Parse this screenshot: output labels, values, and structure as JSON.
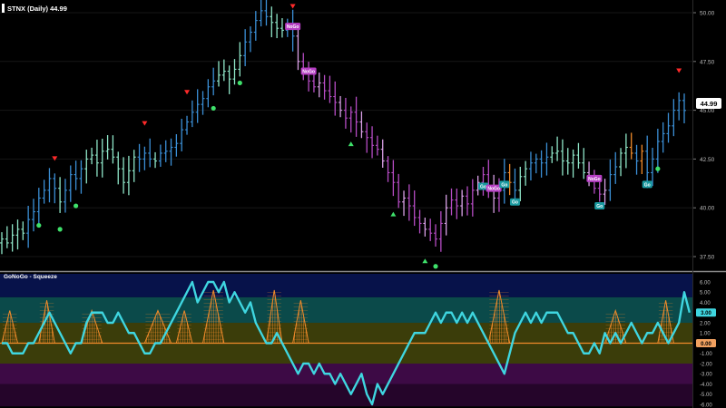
{
  "price_panel": {
    "title": "STNX (Daily) 44.99",
    "last_price_label": "44.99",
    "y_ticks": [
      "50.00",
      "47.50",
      "45.00",
      "42.50",
      "40.00",
      "37.50"
    ]
  },
  "indicator_panel": {
    "title": "GoNoGo - Squeeze",
    "y_ticks": [
      "6.00",
      "5.00",
      "4.00",
      "3.00",
      "2.00",
      "1.00",
      "0.00",
      "-1.00",
      "-2.00",
      "-3.00",
      "-4.00",
      "-5.00",
      "-6.00"
    ],
    "highlight_label": "3.00",
    "zero_label": "0.00"
  },
  "colors": {
    "go_strong": "#3b8fd6",
    "go_weak": "#8fe6c8",
    "nogo_strong": "#b64cc4",
    "nogo_weak": "#d9a0e6",
    "amber": "#f08a2a",
    "oscillator": "#3fd6e0",
    "band_top": "#07124a",
    "band_teal": "#0b4a4a",
    "band_olive": "#3b3d0a",
    "band_purple": "#3d0a45",
    "band_dark_purple": "#25052a"
  },
  "chart_data": [
    {
      "type": "ohlc",
      "title": "STNX (Daily) 44.99",
      "ylim": [
        37.0,
        50.5
      ],
      "series": [
        {
          "name": "price",
          "values": [
            38.4,
            38.2,
            38.6,
            38.9,
            38.7,
            39.4,
            39.8,
            40.5,
            40.9,
            41.5,
            41.0,
            40.3,
            40.9,
            41.7,
            41.5,
            42.0,
            42.5,
            42.7,
            42.3,
            42.9,
            43.0,
            42.6,
            42.0,
            41.3,
            41.9,
            42.6,
            42.5,
            42.8,
            42.5,
            42.4,
            42.8,
            42.9,
            43.1,
            43.3,
            44.0,
            44.4,
            44.9,
            45.3,
            45.6,
            46.2,
            46.5,
            46.8,
            47.0,
            46.6,
            47.1,
            47.8,
            48.5,
            49.0,
            49.6,
            50.1,
            49.8,
            49.5,
            49.2,
            49.1,
            49.4,
            48.8,
            47.5,
            46.9,
            46.5,
            46.2,
            46.4,
            46.0,
            45.7,
            45.4,
            45.0,
            44.6,
            44.9,
            44.4,
            43.9,
            43.6,
            43.2,
            43.0,
            42.4,
            41.8,
            41.3,
            40.3,
            40.5,
            40.1,
            39.5,
            39.2,
            38.9,
            38.7,
            38.4,
            39.2,
            40.0,
            40.4,
            40.1,
            40.6,
            40.2,
            40.9,
            41.3,
            41.7,
            41.1,
            40.5,
            40.9,
            41.8,
            41.3,
            40.9,
            41.6,
            42.0,
            42.3,
            42.5,
            42.3,
            42.6,
            42.8,
            42.9,
            42.4,
            42.3,
            42.7,
            42.3,
            41.8,
            41.4,
            41.0,
            40.7,
            40.9,
            41.7,
            42.1,
            42.8,
            43.1,
            42.8,
            42.4,
            42.9,
            41.8,
            42.5,
            43.4,
            43.8,
            44.2,
            45.0,
            45.5,
            44.99
          ]
        }
      ],
      "markers": [
        {
          "bar": 7,
          "kind": "go_dot"
        },
        {
          "bar": 11,
          "kind": "go_dot"
        },
        {
          "bar": 14,
          "kind": "go_dot"
        },
        {
          "bar": 40,
          "kind": "go_dot"
        },
        {
          "bar": 45,
          "kind": "go_dot"
        },
        {
          "bar": 82,
          "kind": "go_dot"
        },
        {
          "bar": 124,
          "kind": "go_dot"
        },
        {
          "bar": 10,
          "kind": "nogo_triangle"
        },
        {
          "bar": 27,
          "kind": "nogo_triangle"
        },
        {
          "bar": 35,
          "kind": "nogo_triangle"
        },
        {
          "bar": 48,
          "kind": "nogo_triangle"
        },
        {
          "bar": 55,
          "kind": "nogo_triangle"
        },
        {
          "bar": 128,
          "kind": "nogo_triangle"
        },
        {
          "bar": 66,
          "kind": "go_triangle_up"
        },
        {
          "bar": 74,
          "kind": "go_triangle_up"
        },
        {
          "bar": 80,
          "kind": "go_triangle_up"
        }
      ],
      "badges": [
        {
          "bar": 55,
          "text": "NoGo",
          "kind": "nogo"
        },
        {
          "bar": 58,
          "text": "NoGo",
          "kind": "nogo"
        },
        {
          "bar": 91,
          "text": "Go",
          "kind": "go"
        },
        {
          "bar": 93,
          "text": "NoGo",
          "kind": "nogo"
        },
        {
          "bar": 95,
          "text": "Go",
          "kind": "go"
        },
        {
          "bar": 97,
          "text": "Go",
          "kind": "go"
        },
        {
          "bar": 112,
          "text": "NoGo",
          "kind": "nogo"
        },
        {
          "bar": 113,
          "text": "Go",
          "kind": "go"
        },
        {
          "bar": 122,
          "text": "Go",
          "kind": "go"
        }
      ]
    },
    {
      "type": "line",
      "title": "GoNoGo - Squeeze",
      "ylim": [
        -6.2,
        6.8
      ],
      "series": [
        {
          "name": "oscillator",
          "values": [
            0,
            0,
            -1,
            -1,
            -1,
            0,
            0,
            1,
            2,
            3,
            2,
            1,
            0,
            -1,
            0,
            0,
            2,
            3,
            3,
            3,
            2,
            2,
            3,
            2,
            1,
            1,
            0,
            -1,
            -1,
            0,
            0,
            1,
            2,
            3,
            4,
            5,
            6,
            4,
            5,
            6,
            6,
            5,
            6,
            4,
            5,
            4,
            3,
            4,
            2,
            1,
            0,
            0,
            1,
            0,
            -1,
            -2,
            -3,
            -2,
            -2,
            -3,
            -2,
            -3,
            -3,
            -4,
            -3,
            -4,
            -5,
            -4,
            -3,
            -5,
            -6,
            -4,
            -5,
            -4,
            -3,
            -2,
            -1,
            0,
            1,
            1,
            1,
            2,
            3,
            2,
            3,
            3,
            2,
            3,
            2,
            3,
            2,
            1,
            0,
            -1,
            -2,
            -3,
            -1,
            1,
            2,
            3,
            2,
            3,
            2,
            3,
            3,
            3,
            2,
            1,
            1,
            0,
            -1,
            -1,
            0,
            -1,
            1,
            0,
            1,
            0,
            1,
            2,
            1,
            0,
            1,
            1,
            2,
            1,
            0,
            1,
            2,
            5,
            3
          ]
        }
      ],
      "squeeze_ranges": [
        [
          0,
          3
        ],
        [
          7,
          10
        ],
        [
          15,
          19
        ],
        [
          27,
          32
        ],
        [
          33,
          36
        ],
        [
          38,
          42
        ],
        [
          50,
          53
        ],
        [
          55,
          58
        ],
        [
          92,
          96
        ],
        [
          114,
          118
        ],
        [
          124,
          127
        ]
      ]
    }
  ]
}
